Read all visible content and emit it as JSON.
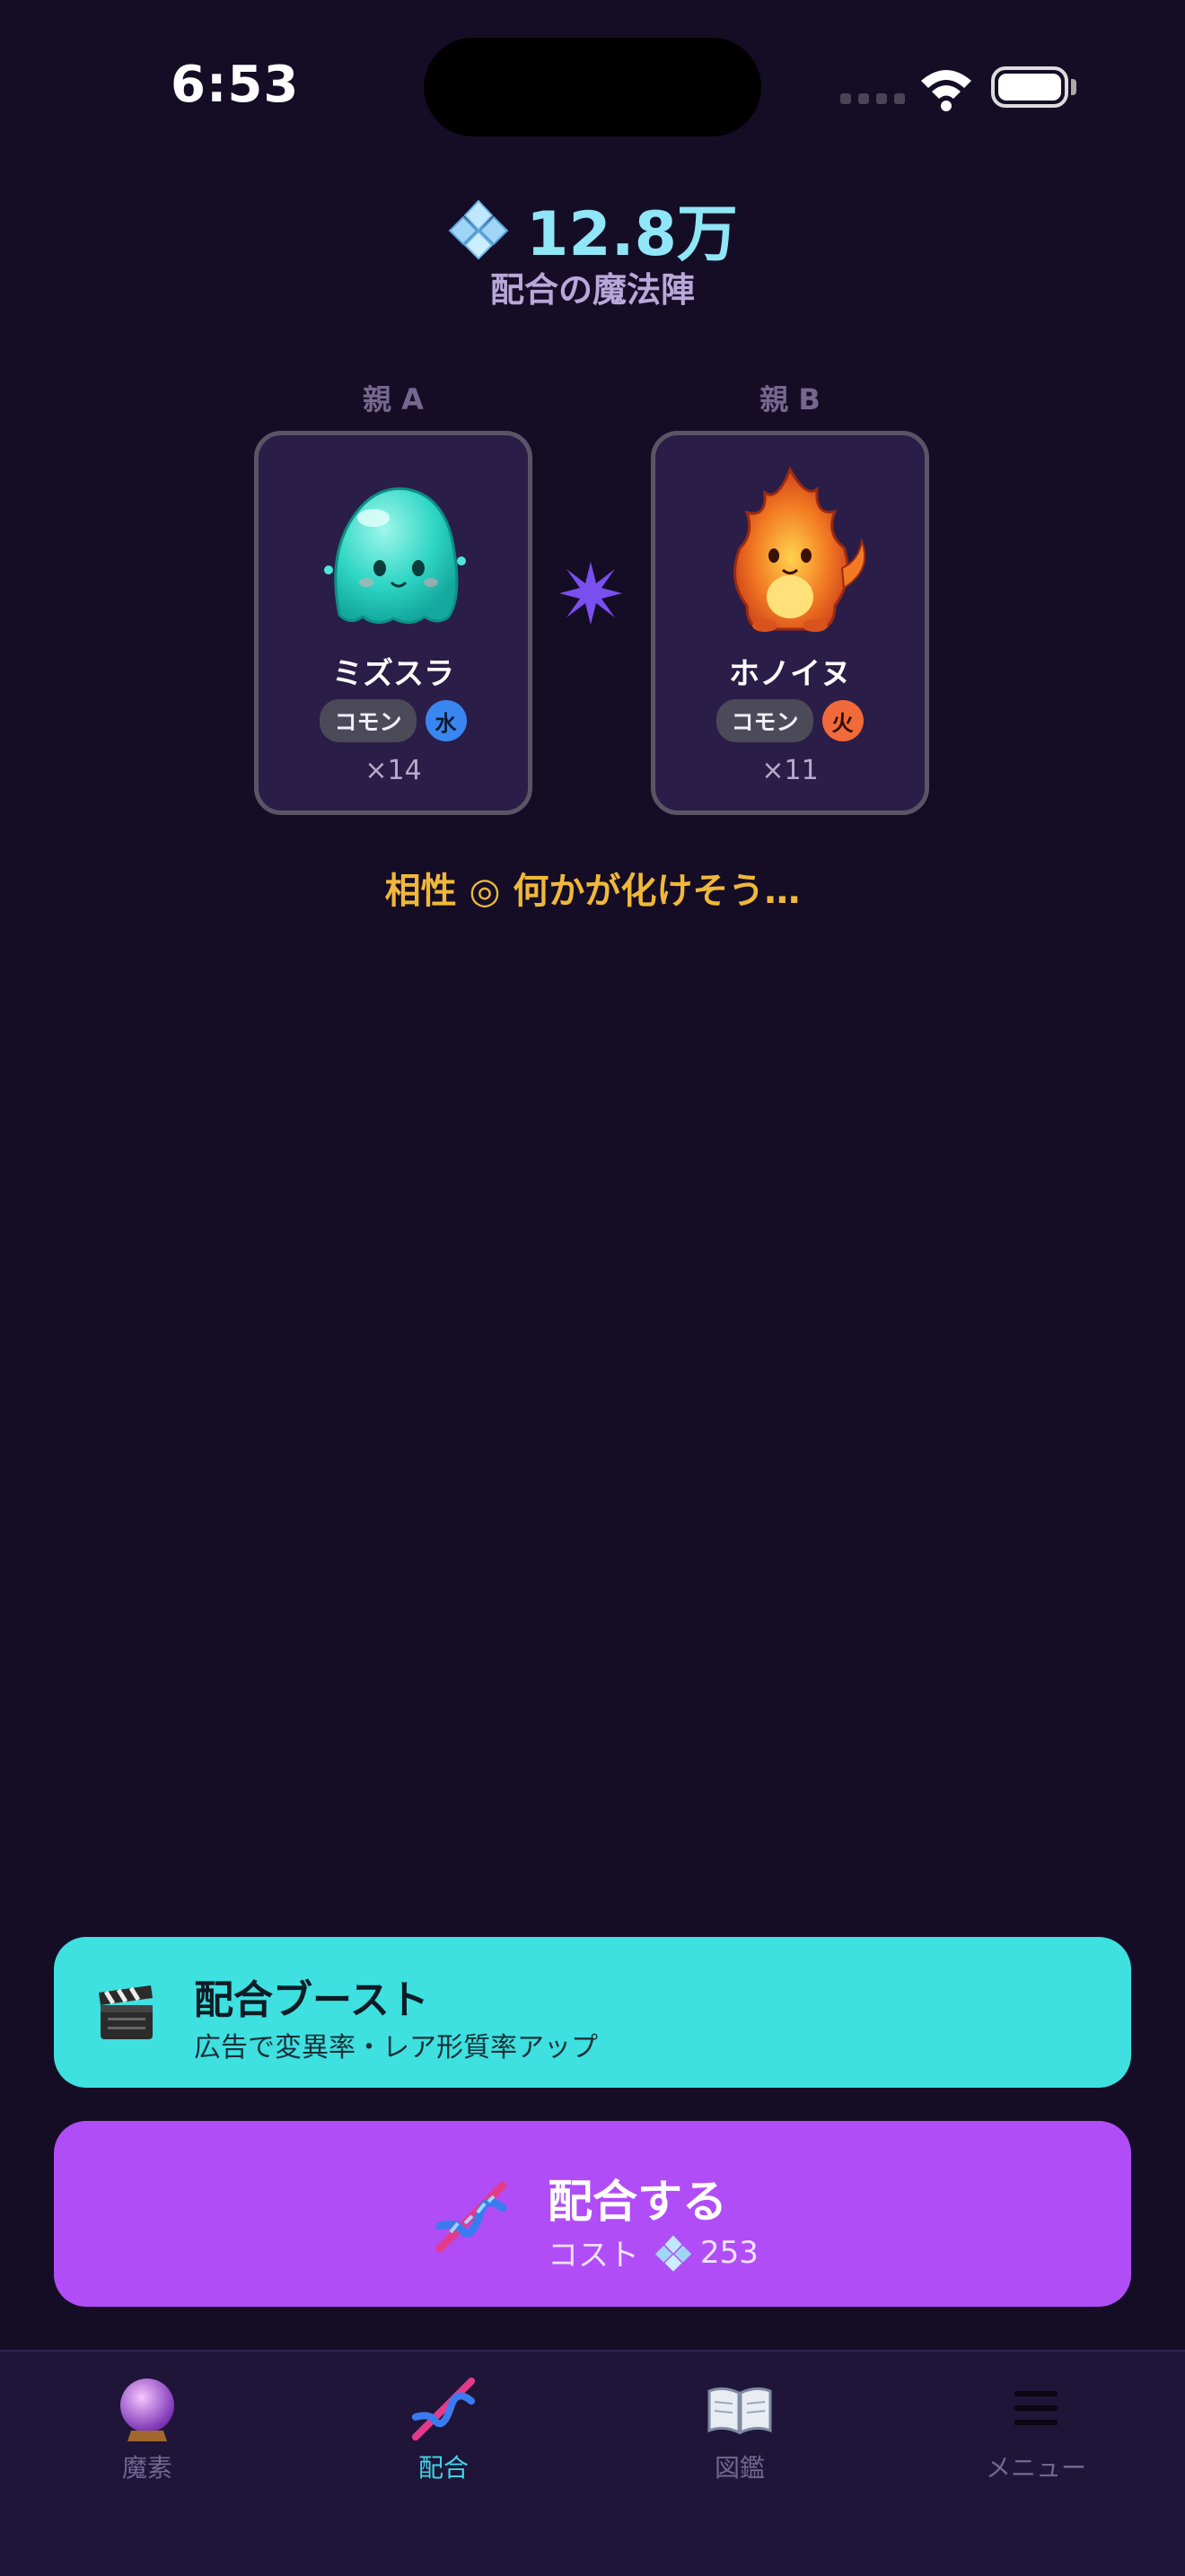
{
  "status_bar": {
    "time": "6:53"
  },
  "header": {
    "currency_amount": "12.8万",
    "subtitle": "配合の魔法陣"
  },
  "parents": [
    {
      "label": "親 A",
      "name": "ミズスラ",
      "rarity": "コモン",
      "element": "水",
      "element_color": "#3a86f0",
      "count": "×14",
      "icon": "water-slime-icon"
    },
    {
      "label": "親 B",
      "name": "ホノイヌ",
      "rarity": "コモン",
      "element": "火",
      "element_color": "#f06a3a",
      "count": "×11",
      "icon": "fire-dog-icon"
    }
  ],
  "compatibility": "相性 ◎ 何かが化けそう…",
  "boost_button": {
    "title": "配合ブースト",
    "description": "広告で変異率・レア形質率アップ",
    "icon": "clapper-icon"
  },
  "breed_button": {
    "title": "配合する",
    "cost_label": "コスト",
    "cost_value": "253",
    "icon": "dna-icon"
  },
  "tabs": [
    {
      "label": "魔素",
      "icon": "crystal-ball-icon",
      "active": false
    },
    {
      "label": "配合",
      "icon": "dna-icon",
      "active": true
    },
    {
      "label": "図鑑",
      "icon": "book-icon",
      "active": false
    },
    {
      "label": "メニュー",
      "icon": "menu-icon",
      "active": false
    }
  ],
  "colors": {
    "background": "#150d26",
    "accent_cyan": "#3ee0e0",
    "accent_purple": "#b14df7",
    "highlight": "#f0b83a"
  }
}
